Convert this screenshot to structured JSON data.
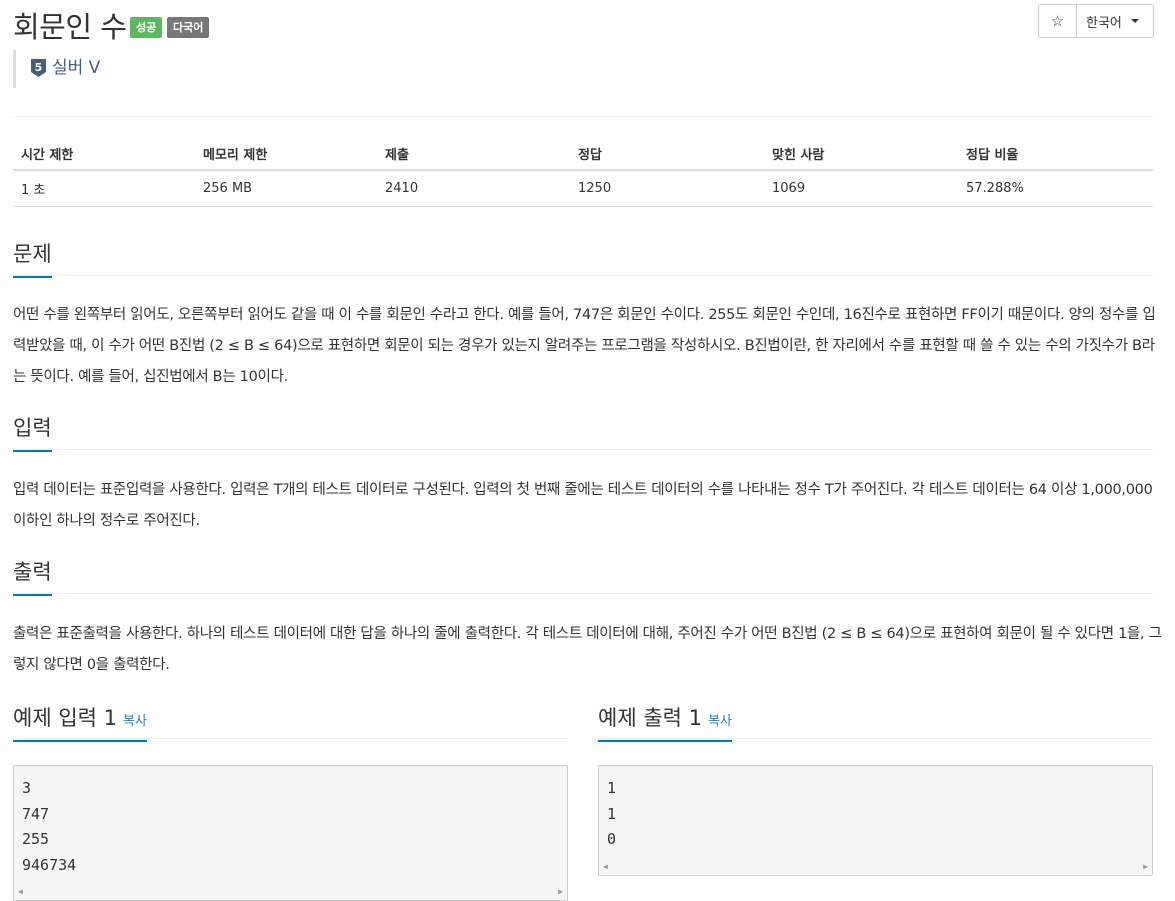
{
  "header": {
    "title": "회문인 수",
    "label_success": "성공",
    "label_multilang": "다국어",
    "star_icon": "☆",
    "language": "한국어"
  },
  "tier": {
    "number": "5",
    "text": "실버 V",
    "color": "#435f7a"
  },
  "info_table": {
    "headers": [
      "시간 제한",
      "메모리 제한",
      "제출",
      "정답",
      "맞힌 사람",
      "정답 비율"
    ],
    "values": [
      "1 초",
      "256 MB",
      "2410",
      "1250",
      "1069",
      "57.288%"
    ]
  },
  "problem": {
    "title": "문제",
    "text": "어떤 수를 왼쪽부터 읽어도, 오른쪽부터 읽어도 같을 때 이 수를 회문인 수라고 한다. 예를 들어, 747은 회문인 수이다. 255도 회문인 수인데, 16진수로 표현하면 FF이기 때문이다. 양의 정수를 입력받았을 때, 이 수가 어떤 B진법 (2 ≤ B ≤ 64)으로 표현하면 회문이 되는 경우가 있는지 알려주는 프로그램을 작성하시오. B진법이란, 한 자리에서 수를 표현할 때 쓸 수 있는 수의 가짓수가 B라는 뜻이다. 예를 들어, 십진법에서 B는 10이다."
  },
  "input": {
    "title": "입력",
    "text": "입력 데이터는 표준입력을 사용한다. 입력은 T개의 테스트 데이터로 구성된다. 입력의 첫 번째 줄에는 테스트 데이터의 수를 나타내는 정수 T가 주어진다. 각 테스트 데이터는 64 이상 1,000,000 이하인 하나의 정수로 주어진다."
  },
  "output": {
    "title": "출력",
    "text": "출력은 표준출력을 사용한다. 하나의 테스트 데이터에 대한 답을 하나의 줄에 출력한다. 각 테스트 데이터에 대해, 주어진 수가 어떤 B진법 (2 ≤ B ≤ 64)으로 표현하여 회문이 될 수 있다면 1을, 그렇지 않다면 0을 출력한다."
  },
  "sample_input": {
    "title": "예제 입력 1",
    "copy": "복사",
    "lines": [
      "3",
      "747",
      "255",
      "946734"
    ]
  },
  "sample_output": {
    "title": "예제 출력 1",
    "copy": "복사",
    "lines": [
      "1",
      "1",
      "0"
    ]
  },
  "colors": {
    "accent": "#0076c0",
    "success": "#5cb85c",
    "multilang": "#777777",
    "link": "#337ab7"
  }
}
